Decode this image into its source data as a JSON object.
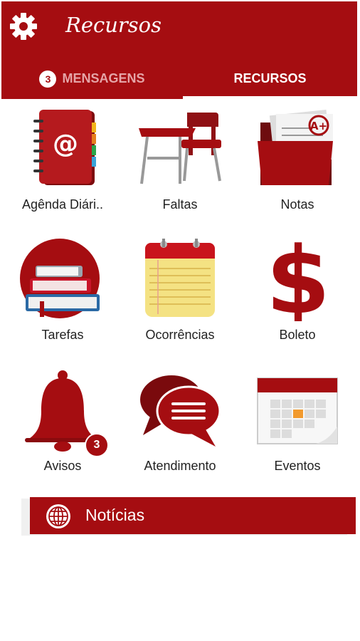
{
  "app_bar": {
    "title": "Recursos",
    "settings_icon": "gear-icon",
    "color": "#a50d11"
  },
  "tabs": [
    {
      "label": "MENSAGENS",
      "badge": "3",
      "active": false
    },
    {
      "label": "RECURSOS",
      "active": true
    }
  ],
  "resources": [
    {
      "label": "Agênda Diári..",
      "icon": "address-book-icon"
    },
    {
      "label": "Faltas",
      "icon": "school-desk-icon"
    },
    {
      "label": "Notas",
      "icon": "grades-folder-icon"
    },
    {
      "label": "Tarefas",
      "icon": "books-icon"
    },
    {
      "label": "Ocorrências",
      "icon": "notepad-icon"
    },
    {
      "label": "Boleto",
      "icon": "dollar-icon"
    },
    {
      "label": "Avisos",
      "icon": "bell-icon",
      "badge": "3"
    },
    {
      "label": "Atendimento",
      "icon": "chat-bubbles-icon"
    },
    {
      "label": "Eventos",
      "icon": "calendar-icon"
    }
  ],
  "news": {
    "label": "Notícias",
    "icon": "globe-icon"
  }
}
